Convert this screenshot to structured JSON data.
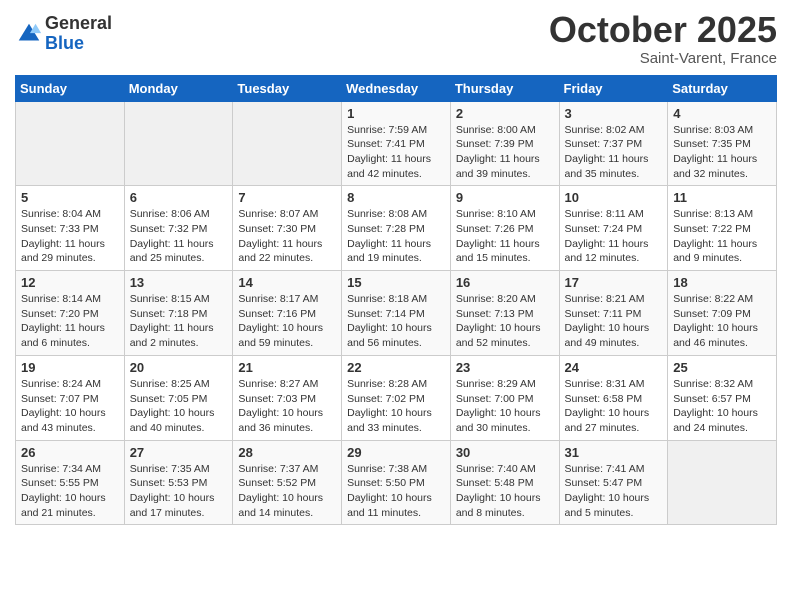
{
  "header": {
    "logo_general": "General",
    "logo_blue": "Blue",
    "month_title": "October 2025",
    "location": "Saint-Varent, France"
  },
  "weekdays": [
    "Sunday",
    "Monday",
    "Tuesday",
    "Wednesday",
    "Thursday",
    "Friday",
    "Saturday"
  ],
  "weeks": [
    [
      {
        "day": "",
        "empty": true
      },
      {
        "day": "",
        "empty": true
      },
      {
        "day": "",
        "empty": true
      },
      {
        "day": "1",
        "sunrise": "Sunrise: 7:59 AM",
        "sunset": "Sunset: 7:41 PM",
        "daylight": "Daylight: 11 hours and 42 minutes."
      },
      {
        "day": "2",
        "sunrise": "Sunrise: 8:00 AM",
        "sunset": "Sunset: 7:39 PM",
        "daylight": "Daylight: 11 hours and 39 minutes."
      },
      {
        "day": "3",
        "sunrise": "Sunrise: 8:02 AM",
        "sunset": "Sunset: 7:37 PM",
        "daylight": "Daylight: 11 hours and 35 minutes."
      },
      {
        "day": "4",
        "sunrise": "Sunrise: 8:03 AM",
        "sunset": "Sunset: 7:35 PM",
        "daylight": "Daylight: 11 hours and 32 minutes."
      }
    ],
    [
      {
        "day": "5",
        "sunrise": "Sunrise: 8:04 AM",
        "sunset": "Sunset: 7:33 PM",
        "daylight": "Daylight: 11 hours and 29 minutes."
      },
      {
        "day": "6",
        "sunrise": "Sunrise: 8:06 AM",
        "sunset": "Sunset: 7:32 PM",
        "daylight": "Daylight: 11 hours and 25 minutes."
      },
      {
        "day": "7",
        "sunrise": "Sunrise: 8:07 AM",
        "sunset": "Sunset: 7:30 PM",
        "daylight": "Daylight: 11 hours and 22 minutes."
      },
      {
        "day": "8",
        "sunrise": "Sunrise: 8:08 AM",
        "sunset": "Sunset: 7:28 PM",
        "daylight": "Daylight: 11 hours and 19 minutes."
      },
      {
        "day": "9",
        "sunrise": "Sunrise: 8:10 AM",
        "sunset": "Sunset: 7:26 PM",
        "daylight": "Daylight: 11 hours and 15 minutes."
      },
      {
        "day": "10",
        "sunrise": "Sunrise: 8:11 AM",
        "sunset": "Sunset: 7:24 PM",
        "daylight": "Daylight: 11 hours and 12 minutes."
      },
      {
        "day": "11",
        "sunrise": "Sunrise: 8:13 AM",
        "sunset": "Sunset: 7:22 PM",
        "daylight": "Daylight: 11 hours and 9 minutes."
      }
    ],
    [
      {
        "day": "12",
        "sunrise": "Sunrise: 8:14 AM",
        "sunset": "Sunset: 7:20 PM",
        "daylight": "Daylight: 11 hours and 6 minutes."
      },
      {
        "day": "13",
        "sunrise": "Sunrise: 8:15 AM",
        "sunset": "Sunset: 7:18 PM",
        "daylight": "Daylight: 11 hours and 2 minutes."
      },
      {
        "day": "14",
        "sunrise": "Sunrise: 8:17 AM",
        "sunset": "Sunset: 7:16 PM",
        "daylight": "Daylight: 10 hours and 59 minutes."
      },
      {
        "day": "15",
        "sunrise": "Sunrise: 8:18 AM",
        "sunset": "Sunset: 7:14 PM",
        "daylight": "Daylight: 10 hours and 56 minutes."
      },
      {
        "day": "16",
        "sunrise": "Sunrise: 8:20 AM",
        "sunset": "Sunset: 7:13 PM",
        "daylight": "Daylight: 10 hours and 52 minutes."
      },
      {
        "day": "17",
        "sunrise": "Sunrise: 8:21 AM",
        "sunset": "Sunset: 7:11 PM",
        "daylight": "Daylight: 10 hours and 49 minutes."
      },
      {
        "day": "18",
        "sunrise": "Sunrise: 8:22 AM",
        "sunset": "Sunset: 7:09 PM",
        "daylight": "Daylight: 10 hours and 46 minutes."
      }
    ],
    [
      {
        "day": "19",
        "sunrise": "Sunrise: 8:24 AM",
        "sunset": "Sunset: 7:07 PM",
        "daylight": "Daylight: 10 hours and 43 minutes."
      },
      {
        "day": "20",
        "sunrise": "Sunrise: 8:25 AM",
        "sunset": "Sunset: 7:05 PM",
        "daylight": "Daylight: 10 hours and 40 minutes."
      },
      {
        "day": "21",
        "sunrise": "Sunrise: 8:27 AM",
        "sunset": "Sunset: 7:03 PM",
        "daylight": "Daylight: 10 hours and 36 minutes."
      },
      {
        "day": "22",
        "sunrise": "Sunrise: 8:28 AM",
        "sunset": "Sunset: 7:02 PM",
        "daylight": "Daylight: 10 hours and 33 minutes."
      },
      {
        "day": "23",
        "sunrise": "Sunrise: 8:29 AM",
        "sunset": "Sunset: 7:00 PM",
        "daylight": "Daylight: 10 hours and 30 minutes."
      },
      {
        "day": "24",
        "sunrise": "Sunrise: 8:31 AM",
        "sunset": "Sunset: 6:58 PM",
        "daylight": "Daylight: 10 hours and 27 minutes."
      },
      {
        "day": "25",
        "sunrise": "Sunrise: 8:32 AM",
        "sunset": "Sunset: 6:57 PM",
        "daylight": "Daylight: 10 hours and 24 minutes."
      }
    ],
    [
      {
        "day": "26",
        "sunrise": "Sunrise: 7:34 AM",
        "sunset": "Sunset: 5:55 PM",
        "daylight": "Daylight: 10 hours and 21 minutes."
      },
      {
        "day": "27",
        "sunrise": "Sunrise: 7:35 AM",
        "sunset": "Sunset: 5:53 PM",
        "daylight": "Daylight: 10 hours and 17 minutes."
      },
      {
        "day": "28",
        "sunrise": "Sunrise: 7:37 AM",
        "sunset": "Sunset: 5:52 PM",
        "daylight": "Daylight: 10 hours and 14 minutes."
      },
      {
        "day": "29",
        "sunrise": "Sunrise: 7:38 AM",
        "sunset": "Sunset: 5:50 PM",
        "daylight": "Daylight: 10 hours and 11 minutes."
      },
      {
        "day": "30",
        "sunrise": "Sunrise: 7:40 AM",
        "sunset": "Sunset: 5:48 PM",
        "daylight": "Daylight: 10 hours and 8 minutes."
      },
      {
        "day": "31",
        "sunrise": "Sunrise: 7:41 AM",
        "sunset": "Sunset: 5:47 PM",
        "daylight": "Daylight: 10 hours and 5 minutes."
      },
      {
        "day": "",
        "empty": true
      }
    ]
  ]
}
